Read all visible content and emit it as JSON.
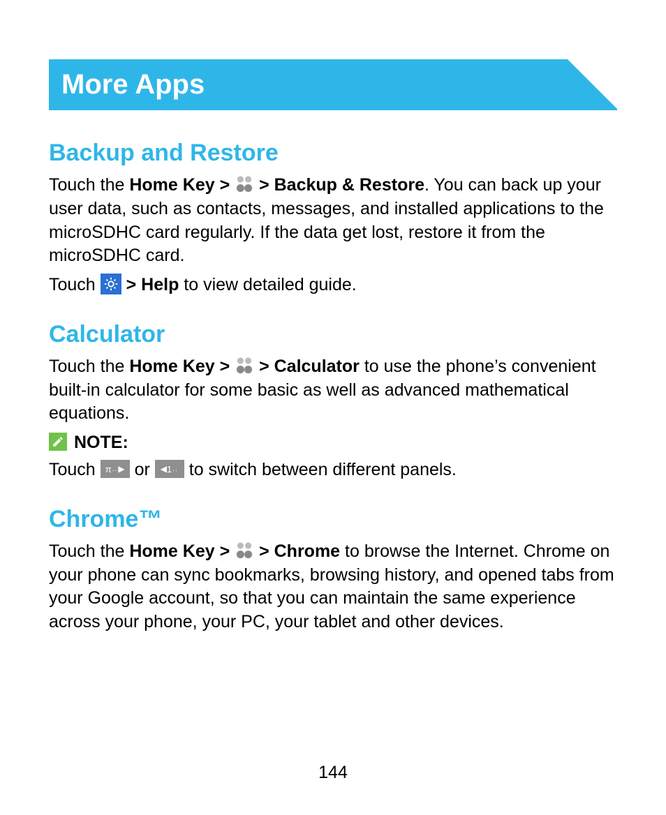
{
  "banner": {
    "title": "More Apps"
  },
  "sections": {
    "backup": {
      "heading": "Backup and Restore",
      "p1_pre": "Touch the ",
      "p1_home": "Home Key > ",
      "p1_mid": " > Backup & Restore",
      "p1_post": ". You can back up your user data, such as contacts, messages, and installed applications to the microSDHC card regularly. If the data get lost, restore it from the microSDHC card.",
      "p2_pre": "Touch ",
      "p2_mid": " > Help",
      "p2_post": " to view detailed guide."
    },
    "calculator": {
      "heading": "Calculator",
      "p1_pre": "Touch the ",
      "p1_home": "Home Key > ",
      "p1_mid": " > Calculator",
      "p1_post": " to use the phone’s convenient built-in calculator for some basic as well as advanced mathematical equations.",
      "note_label": "NOTE:",
      "p2_pre": "Touch ",
      "p2_or": " or ",
      "p2_post": " to switch between different panels."
    },
    "chrome": {
      "heading": "Chrome™",
      "p1_pre": "Touch the ",
      "p1_home": "Home Key > ",
      "p1_mid": " > Chrome",
      "p1_post": " to browse the Internet. Chrome on your phone can sync bookmarks, browsing history, and opened tabs from your Google account, so that you can maintain the same experience across your phone, your PC, your tablet and other devices."
    }
  },
  "panel_icons": {
    "pi": "π",
    "one": "1"
  },
  "page_number": "144"
}
